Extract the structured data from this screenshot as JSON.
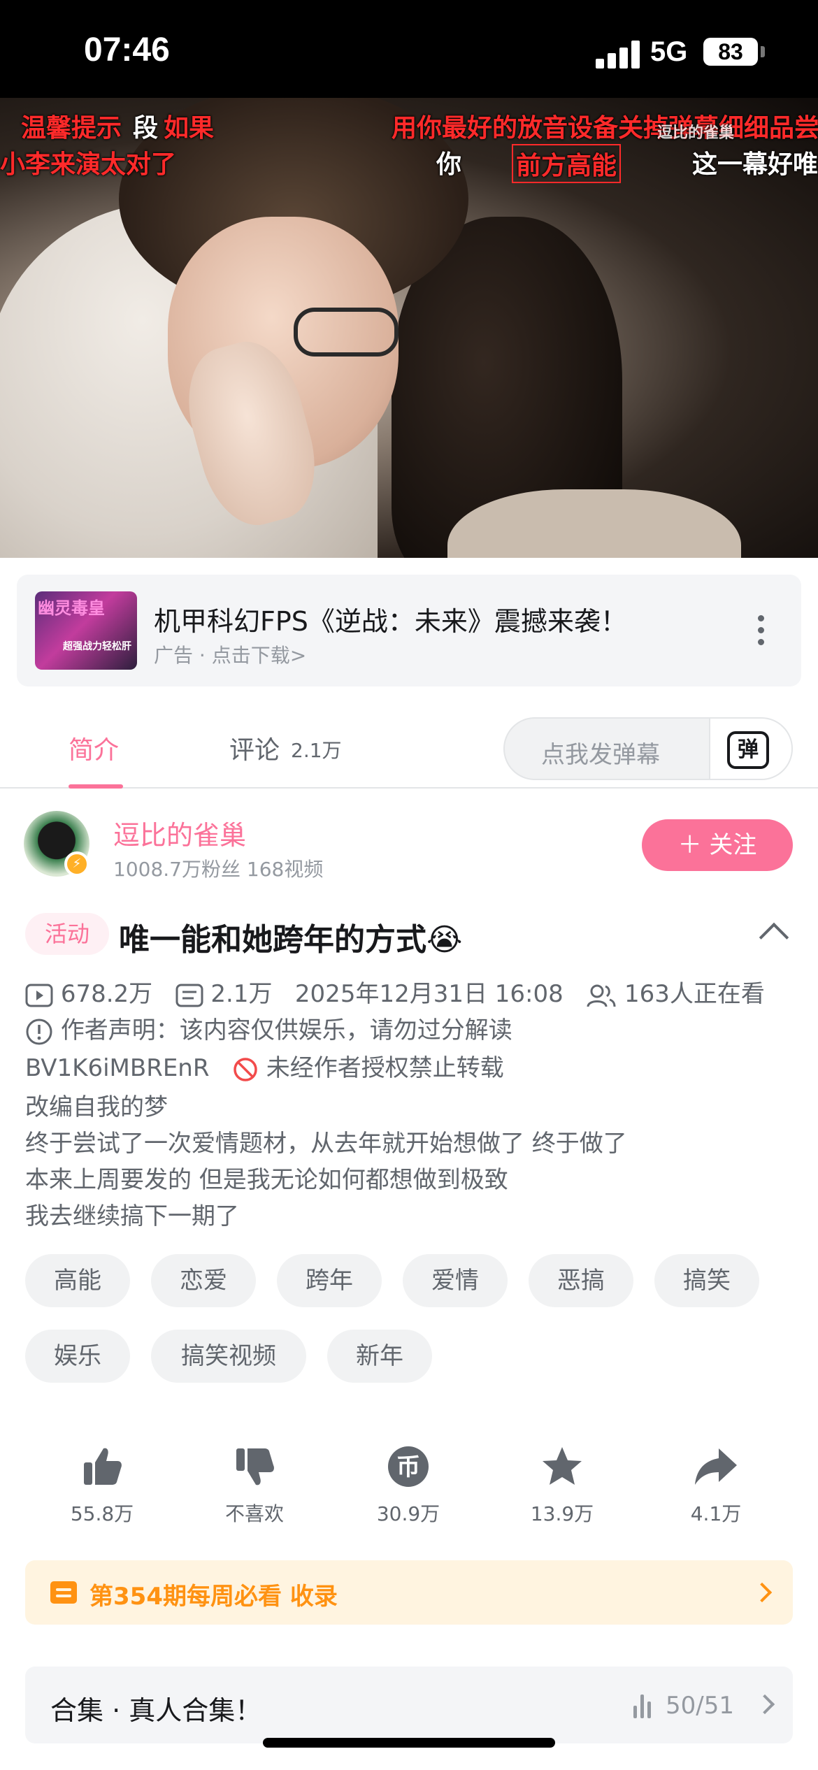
{
  "status_bar": {
    "time": "07:46",
    "network": "5G",
    "battery": "83"
  },
  "video": {
    "progress": 0.82,
    "danmaku": [
      {
        "text": "温馨提示",
        "color": "#ff2a2a"
      },
      {
        "text": "段",
        "color": "#ffffff"
      },
      {
        "text": "如果",
        "color": "#ff2a2a"
      },
      {
        "text": "用你最好的放音设备关掉弹幕细细品尝",
        "color": "#ff2a2a"
      },
      {
        "text": "小李来演太对了",
        "color": "#ff2a2a"
      },
      {
        "text": "你",
        "color": "#ffffff"
      },
      {
        "text": "前方高能",
        "color": "#ff2a2a"
      },
      {
        "text": "这一幕好唯美",
        "color": "#ffffff"
      },
      {
        "text": "逗比的雀巢",
        "color": "#ffffff"
      }
    ]
  },
  "ad": {
    "thumb_title": "幽灵毒皇",
    "thumb_text": "超强战力轻松肝",
    "title": "机甲科幻FPS《逆战：未来》震撼来袭！",
    "subtitle": "广告 · 点击下载>"
  },
  "tabs": {
    "intro": "简介",
    "comments": "评论",
    "comments_count": "2.1万",
    "danmaku_placeholder": "点我发弹幕",
    "danmaku_button": "弹"
  },
  "uploader": {
    "name": "逗比的雀巢",
    "stats": "1008.7万粉丝  168视频",
    "follow_label": "＋ 关注"
  },
  "video_info": {
    "activity_tag": "活动",
    "title": "唯一能和她跨年的方式😭",
    "views": "678.2万",
    "danmaku_count": "2.1万",
    "date": "2025年12月31日 16:08",
    "watching": "163人正在看",
    "statement": "作者声明：该内容仅供娱乐，请勿过分解读",
    "bvid": "BV1K6iMBREnR",
    "no_repost": "未经作者授权禁止转载",
    "description": [
      "改编自我的梦",
      "终于尝试了一次爱情题材，从去年就开始想做了 终于做了",
      "本来上周要发的 但是我无论如何都想做到极致",
      "我去继续搞下一期了"
    ]
  },
  "tags": [
    "高能",
    "恋爱",
    "跨年",
    "爱情",
    "恶搞",
    "搞笑",
    "娱乐",
    "搞笑视频",
    "新年"
  ],
  "actions": {
    "like": "55.8万",
    "dislike": "不喜欢",
    "coin": "30.9万",
    "favorite": "13.9万",
    "share": "4.1万"
  },
  "weekly": {
    "label": "第354期每周必看",
    "suffix": "收录"
  },
  "collection": {
    "label": "合集 · 真人合集！",
    "count": "50/51"
  },
  "colors": {
    "accent": "#fb7299",
    "weekly": "#ff9212",
    "text_secondary": "#61666d",
    "text_tertiary": "#9499a0"
  }
}
